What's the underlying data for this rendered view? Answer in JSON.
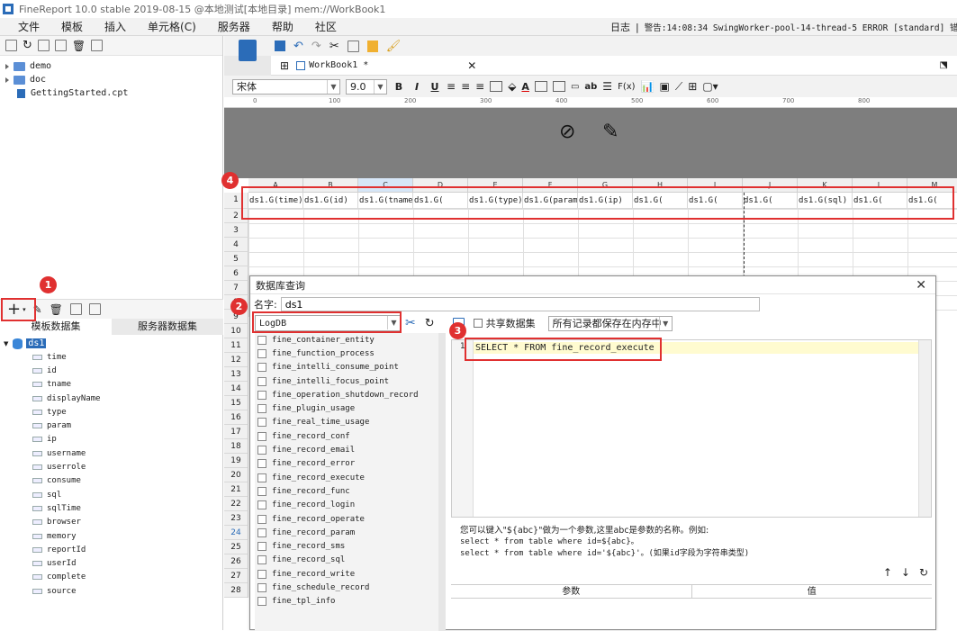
{
  "titlebar": {
    "text": "FineReport 10.0 stable 2019-08-15 @本地测试[本地目录]    mem://WorkBook1"
  },
  "menu": [
    "文件",
    "模板",
    "插入",
    "单元格(C)",
    "服务器",
    "帮助",
    "社区"
  ],
  "status": {
    "log_label": "日志",
    "warning": "警告:14:08:34 SwingWorker-pool-14-thread-5 ERROR [standard] 错误代码"
  },
  "file_tree": [
    {
      "label": "demo",
      "type": "folder"
    },
    {
      "label": "doc",
      "type": "folder"
    },
    {
      "label": "GettingStarted.cpt",
      "type": "file"
    }
  ],
  "dataset_tabs": {
    "template": "模板数据集",
    "server": "服务器数据集"
  },
  "dataset": {
    "name": "ds1",
    "fields": [
      "time",
      "id",
      "tname",
      "displayName",
      "type",
      "param",
      "ip",
      "username",
      "userrole",
      "consume",
      "sql",
      "sqlTime",
      "browser",
      "memory",
      "reportId",
      "userId",
      "complete",
      "source"
    ]
  },
  "tab": {
    "label": "WorkBook1 *"
  },
  "format": {
    "font": "宋体",
    "size": "9.0"
  },
  "ruler": [
    "0",
    "100",
    "200",
    "300",
    "400",
    "500",
    "600",
    "700",
    "800"
  ],
  "columns": [
    "A",
    "B",
    "C",
    "D",
    "E",
    "F",
    "G",
    "H",
    "I",
    "J",
    "K",
    "L",
    "M"
  ],
  "rows": [
    "1",
    "2",
    "3",
    "4",
    "5",
    "6",
    "7",
    "8",
    "9",
    "10",
    "11",
    "12",
    "13",
    "14",
    "15",
    "16",
    "17",
    "18",
    "19",
    "20",
    "21",
    "22",
    "23",
    "24",
    "25",
    "26",
    "27",
    "28"
  ],
  "row1_cells": [
    "ds1.G(time)",
    "ds1.G(id)",
    "ds1.G(tname",
    "ds1.G(",
    "ds1.G(type)",
    "ds1.G(param",
    "ds1.G(ip)",
    "ds1.G(",
    "ds1.G(",
    "ds1.G(",
    "ds1.G(sql)",
    "ds1.G(",
    "ds1.G("
  ],
  "dialog": {
    "title": "数据库查询",
    "name_label": "名字:",
    "name_value": "ds1",
    "database": "LogDB",
    "share_label": "共享数据集",
    "memory_option": "所有记录都保存在内存中",
    "tables": [
      "fine_container_entity",
      "fine_function_process",
      "fine_intelli_consume_point",
      "fine_intelli_focus_point",
      "fine_operation_shutdown_record",
      "fine_plugin_usage",
      "fine_real_time_usage",
      "fine_record_conf",
      "fine_record_email",
      "fine_record_error",
      "fine_record_execute",
      "fine_record_func",
      "fine_record_login",
      "fine_record_operate",
      "fine_record_param",
      "fine_record_sms",
      "fine_record_sql",
      "fine_record_write",
      "fine_schedule_record",
      "fine_tpl_info"
    ],
    "sql_line_no": "1",
    "sql": "SELECT * FROM fine_record_execute",
    "help_lines": [
      "您可以键入\"${abc}\"做为一个参数,这里abc是参数的名称。例如:",
      "select * from table where id=${abc}。",
      "select * from table where id='${abc}'。(如果id字段为字符串类型)"
    ],
    "param_col": "参数",
    "value_col": "值"
  },
  "badges": [
    "1",
    "2",
    "3",
    "4"
  ],
  "colors": {
    "annotation": "#e03030",
    "accent": "#2b6cb8"
  }
}
